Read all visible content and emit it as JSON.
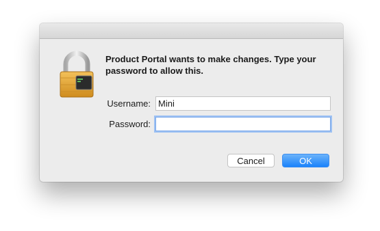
{
  "dialog": {
    "message": "Product Portal wants to make changes. Type your password to allow this.",
    "icon": "padlock-terminal-icon"
  },
  "form": {
    "username_label": "Username:",
    "username_value": "Mini",
    "password_label": "Password:",
    "password_value": ""
  },
  "buttons": {
    "cancel_label": "Cancel",
    "ok_label": "OK"
  },
  "colors": {
    "accent": "#1a82fb",
    "focus_ring": "#9dc1f3",
    "dialog_bg": "#ececec",
    "lock_gold": "#e0a63a"
  }
}
